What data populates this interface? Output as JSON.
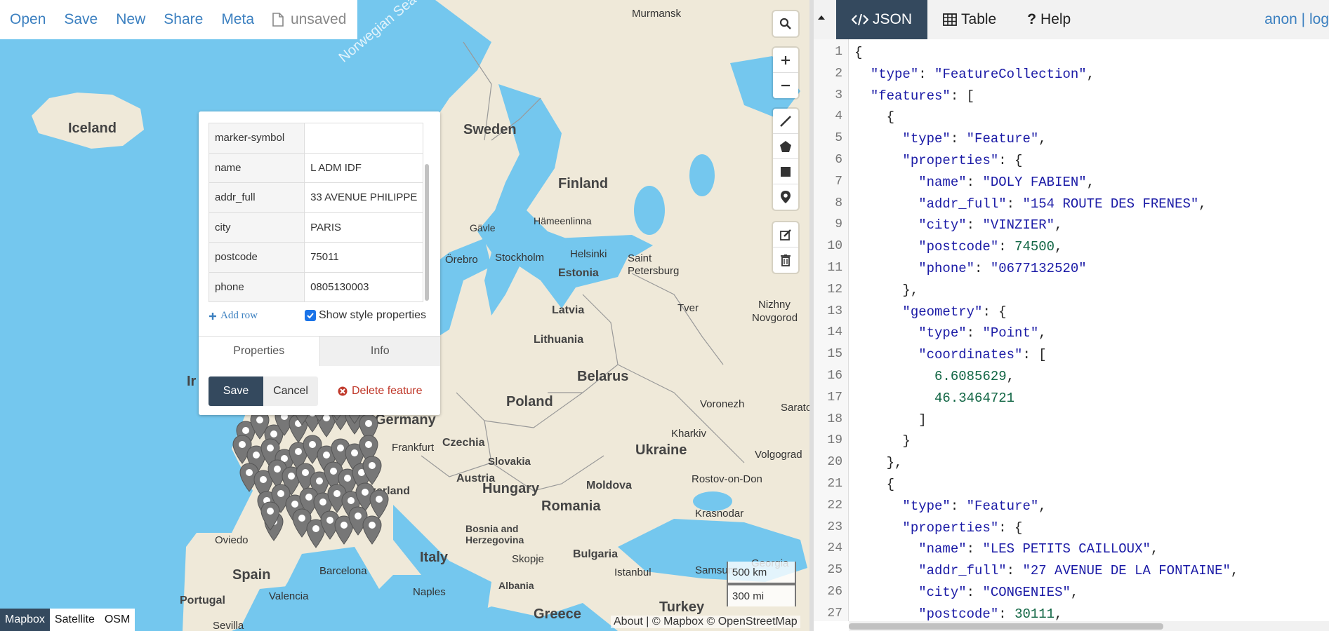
{
  "topbar": {
    "menu": [
      "Open",
      "Save",
      "New",
      "Share",
      "Meta"
    ],
    "file_status": "unsaved",
    "file_icon": "file-icon"
  },
  "map": {
    "countries": [
      "Iceland",
      "Sweden",
      "Finland",
      "Estonia",
      "Latvia",
      "Lithuania",
      "Belarus",
      "Poland",
      "Germany",
      "Czechia",
      "Slovakia",
      "Austria",
      "Hungary",
      "Moldova",
      "Ukraine",
      "Romania",
      "Bulgaria",
      "Italy",
      "Spain",
      "Portugal",
      "Turkey",
      "Greece",
      "Albania",
      "Bosnia and",
      "Herzegovina",
      "zerland"
    ],
    "cities": [
      "Murmansk",
      "Gävle",
      "Hämeenlinna",
      "Helsinki",
      "Saint",
      "Petersburg",
      "Örebro",
      "Stockholm",
      "Tver",
      "Nizhny",
      "Novgorod",
      "Frankfurt",
      "Voronezh",
      "Kharkiv",
      "Volgograd",
      "Rostov-on-Don",
      "Krasnodar",
      "Saratov",
      "Skopje",
      "Istanbul",
      "Samsun",
      "Georgia",
      "Naples",
      "Barcelona",
      "Valencia",
      "Oviedo",
      "Sevilla",
      "Ir"
    ],
    "sea_label": "Norwegian Sea",
    "scale": [
      "500 km",
      "300 mi"
    ],
    "attribution": "About | © Mapbox © OpenStreetMap",
    "layers": [
      "Mapbox",
      "Satellite",
      "OSM"
    ],
    "active_layer": "Mapbox"
  },
  "popup": {
    "rows": [
      {
        "key": "marker-symbol",
        "value": ""
      },
      {
        "key": "name",
        "value": "L ADM IDF"
      },
      {
        "key": "addr_full",
        "value": "33 AVENUE PHILIPPE"
      },
      {
        "key": "city",
        "value": "PARIS"
      },
      {
        "key": "postcode",
        "value": "75011"
      },
      {
        "key": "phone",
        "value": "0805130003"
      }
    ],
    "add_row": "Add row",
    "show_style": "Show style properties",
    "show_style_checked": true,
    "tab_properties": "Properties",
    "tab_info": "Info",
    "save": "Save",
    "cancel": "Cancel",
    "delete": "Delete feature"
  },
  "right": {
    "tabs": [
      "JSON",
      "Table",
      "Help"
    ],
    "active_tab": "JSON",
    "user": "anon",
    "logout": "log"
  },
  "code_lines": [
    "{",
    "  \"type\": \"FeatureCollection\",",
    "  \"features\": [",
    "    {",
    "      \"type\": \"Feature\",",
    "      \"properties\": {",
    "        \"name\": \"DOLY FABIEN\",",
    "        \"addr_full\": \"154 ROUTE DES FRENES\",",
    "        \"city\": \"VINZIER\",",
    "        \"postcode\": 74500,",
    "        \"phone\": \"0677132520\"",
    "      },",
    "      \"geometry\": {",
    "        \"type\": \"Point\",",
    "        \"coordinates\": [",
    "          6.6085629,",
    "          46.3464721",
    "        ]",
    "      }",
    "    },",
    "    {",
    "      \"type\": \"Feature\",",
    "      \"properties\": {",
    "        \"name\": \"LES PETITS CAILLOUX\",",
    "        \"addr_full\": \"27 AVENUE DE LA FONTAINE\",",
    "        \"city\": \"CONGENIES\",",
    "        \"postcode\": 30111,"
  ],
  "colors": {
    "accent": "#3c80c0",
    "dark": "#34495e",
    "water": "#74c7ee",
    "land": "#efe9d9",
    "danger": "#c0392b"
  }
}
